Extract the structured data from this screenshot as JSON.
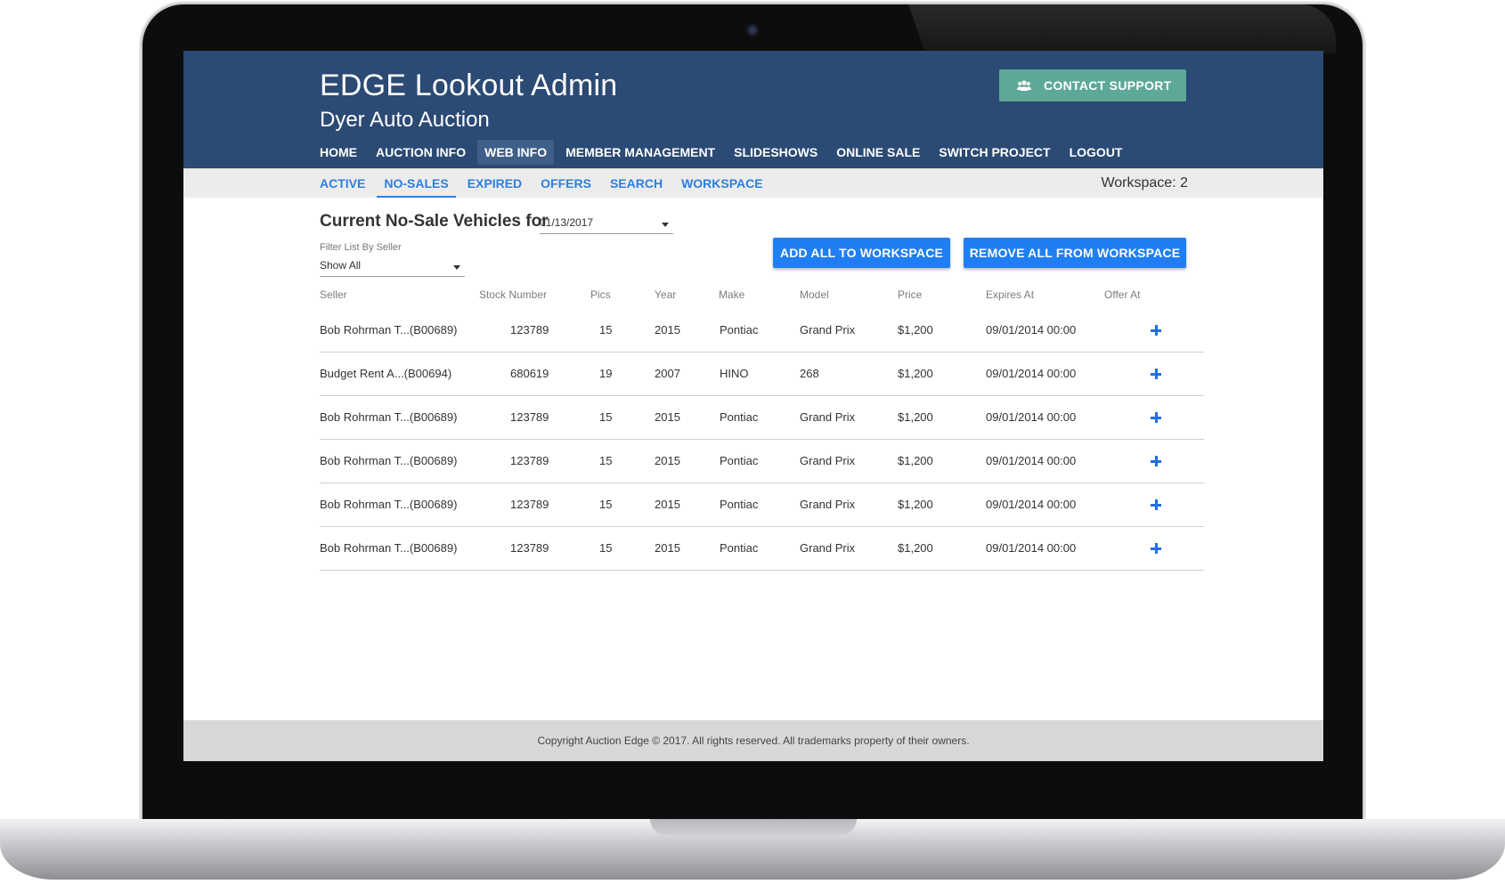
{
  "header": {
    "title": "EDGE Lookout Admin",
    "subtitle": "Dyer Auto Auction",
    "support_label": "CONTACT SUPPORT",
    "support_icon": "users-icon",
    "nav": [
      "HOME",
      "AUCTION INFO",
      "WEB INFO",
      "MEMBER MANAGEMENT",
      "SLIDESHOWS",
      "ONLINE SALE",
      "SWITCH PROJECT",
      "LOGOUT"
    ],
    "nav_active": "WEB INFO",
    "bg_color": "#2b4a74",
    "support_color": "#5ea899"
  },
  "subnav": {
    "tabs": [
      "ACTIVE",
      "NO-SALES",
      "EXPIRED",
      "OFFERS",
      "SEARCH",
      "WORKSPACE"
    ],
    "active": "NO-SALES",
    "workspace_label": "Workspace: 2",
    "accent": "#2b7fe0"
  },
  "content": {
    "title": "Current No-Sale Vehicles for",
    "date_value": "01/13/2017",
    "filter_label": "Filter List By Seller",
    "filter_value": "Show All",
    "add_all_label": "ADD ALL TO WORKSPACE",
    "remove_all_label": "REMOVE ALL FROM WORKSPACE",
    "button_color": "#1f7ff2"
  },
  "table": {
    "columns": {
      "seller": "Seller",
      "stock": "Stock Number",
      "pics": "Pics",
      "year": "Year",
      "make": "Make",
      "model": "Model",
      "price": "Price",
      "expires": "Expires At",
      "offer": "Offer At"
    },
    "rows": [
      {
        "seller": "Bob Rohrman T...(B00689)",
        "stock": "123789",
        "pics": "15",
        "year": "2015",
        "make": "Pontiac",
        "model": "Grand Prix",
        "price": "$1,200",
        "expires": "09/01/2014 00:00"
      },
      {
        "seller": "Budget Rent A...(B00694)",
        "stock": "680619",
        "pics": "19",
        "year": "2007",
        "make": "HINO",
        "model": "268",
        "price": "$1,200",
        "expires": "09/01/2014 00:00"
      },
      {
        "seller": "Bob Rohrman T...(B00689)",
        "stock": "123789",
        "pics": "15",
        "year": "2015",
        "make": "Pontiac",
        "model": "Grand Prix",
        "price": "$1,200",
        "expires": "09/01/2014 00:00"
      },
      {
        "seller": "Bob Rohrman T...(B00689)",
        "stock": "123789",
        "pics": "15",
        "year": "2015",
        "make": "Pontiac",
        "model": "Grand Prix",
        "price": "$1,200",
        "expires": "09/01/2014 00:00"
      },
      {
        "seller": "Bob Rohrman T...(B00689)",
        "stock": "123789",
        "pics": "15",
        "year": "2015",
        "make": "Pontiac",
        "model": "Grand Prix",
        "price": "$1,200",
        "expires": "09/01/2014 00:00"
      },
      {
        "seller": "Bob Rohrman T...(B00689)",
        "stock": "123789",
        "pics": "15",
        "year": "2015",
        "make": "Pontiac",
        "model": "Grand Prix",
        "price": "$1,200",
        "expires": "09/01/2014 00:00"
      }
    ],
    "row_action_icon": "plus-icon"
  },
  "footer": {
    "text": "Copyright Auction Edge © 2017. All rights reserved. All trademarks property of their owners."
  }
}
